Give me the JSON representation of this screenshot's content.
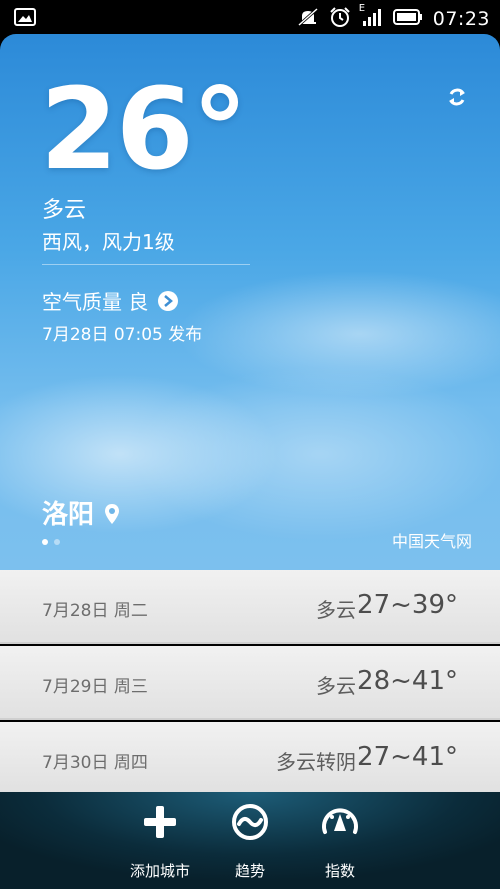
{
  "status": {
    "time": "07:23",
    "network": "E",
    "icons": [
      "screenshot-icon",
      "mute-icon",
      "alarm-icon",
      "signal-icon",
      "battery-icon"
    ]
  },
  "weather": {
    "temperature": "26°",
    "condition": "多云",
    "wind": "西风，风力1级",
    "aqi_label": "空气质量 良",
    "published": "7月28日 07:05 发布",
    "city": "洛阳",
    "source": "中国天气网",
    "page_indicator": {
      "total": 2,
      "current": 1
    }
  },
  "forecast": [
    {
      "date": "7月28日 周二",
      "condition": "多云",
      "range": "27~39°"
    },
    {
      "date": "7月29日 周三",
      "condition": "多云",
      "range": "28~41°"
    },
    {
      "date": "7月30日 周四",
      "condition": "多云转阴",
      "range": "27~41°"
    }
  ],
  "bottom_bar": {
    "add_city": "添加城市",
    "trend": "趋势",
    "index": "指数"
  }
}
